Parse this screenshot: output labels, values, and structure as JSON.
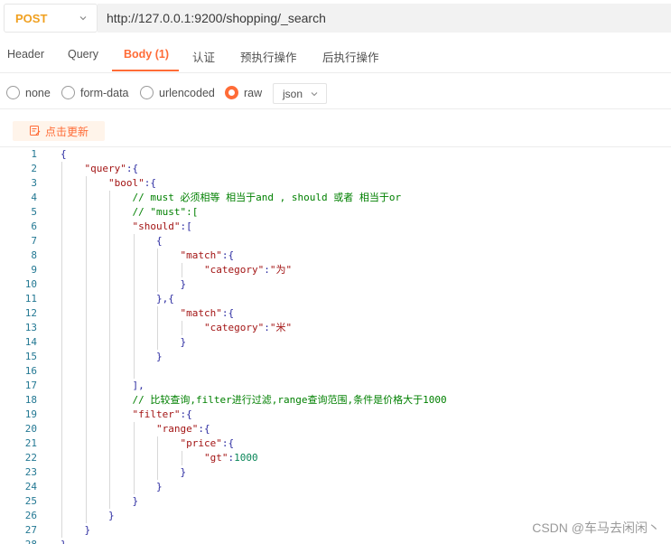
{
  "request": {
    "method": "POST",
    "url": "http://127.0.0.1:9200/shopping/_search"
  },
  "tabs": [
    {
      "label": "Header",
      "active": false
    },
    {
      "label": "Query",
      "active": false
    },
    {
      "label": "Body (1)",
      "active": true
    },
    {
      "label": "认证",
      "active": false
    },
    {
      "label": "预执行操作",
      "active": false
    },
    {
      "label": "后执行操作",
      "active": false
    }
  ],
  "body_type": {
    "options": [
      {
        "label": "none",
        "checked": false
      },
      {
        "label": "form-data",
        "checked": false
      },
      {
        "label": "urlencoded",
        "checked": false
      },
      {
        "label": "raw",
        "checked": true
      }
    ],
    "format": "json"
  },
  "toolbar": {
    "beautify_label": "点击更新",
    "beautify_icon": "beautify-icon"
  },
  "colors": {
    "accent": "#ff6c37",
    "method": "#f0a020",
    "line_number": "#237893",
    "punctuation": "#2a2aa0",
    "key": "#a31515",
    "number": "#098658",
    "comment": "#008000"
  },
  "editor": {
    "lines": [
      {
        "n": "1",
        "indent": 0,
        "tokens": [
          [
            "p",
            "{"
          ]
        ]
      },
      {
        "n": "2",
        "indent": 1,
        "tokens": [
          [
            "k",
            "\"query\""
          ],
          [
            "p",
            ":{"
          ]
        ]
      },
      {
        "n": "3",
        "indent": 2,
        "tokens": [
          [
            "k",
            "\"bool\""
          ],
          [
            "p",
            ":{"
          ]
        ]
      },
      {
        "n": "4",
        "indent": 3,
        "tokens": [
          [
            "c",
            "// must 必须相等 相当于and , should 或者 相当于or"
          ]
        ]
      },
      {
        "n": "5",
        "indent": 3,
        "tokens": [
          [
            "c",
            "// \"must\":["
          ]
        ]
      },
      {
        "n": "6",
        "indent": 3,
        "tokens": [
          [
            "k",
            "\"should\""
          ],
          [
            "p",
            ":["
          ]
        ]
      },
      {
        "n": "7",
        "indent": 4,
        "tokens": [
          [
            "p",
            "{"
          ]
        ]
      },
      {
        "n": "8",
        "indent": 5,
        "tokens": [
          [
            "k",
            "\"match\""
          ],
          [
            "p",
            ":{"
          ]
        ]
      },
      {
        "n": "9",
        "indent": 6,
        "tokens": [
          [
            "k",
            "\"category\""
          ],
          [
            "p",
            ":"
          ],
          [
            "k",
            "\"为\""
          ]
        ]
      },
      {
        "n": "10",
        "indent": 5,
        "tokens": [
          [
            "p",
            "}"
          ]
        ]
      },
      {
        "n": "11",
        "indent": 4,
        "tokens": [
          [
            "p",
            "},{"
          ]
        ]
      },
      {
        "n": "12",
        "indent": 5,
        "tokens": [
          [
            "k",
            "\"match\""
          ],
          [
            "p",
            ":{"
          ]
        ]
      },
      {
        "n": "13",
        "indent": 6,
        "tokens": [
          [
            "k",
            "\"category\""
          ],
          [
            "p",
            ":"
          ],
          [
            "k",
            "\"米\""
          ]
        ]
      },
      {
        "n": "14",
        "indent": 5,
        "tokens": [
          [
            "p",
            "}"
          ]
        ]
      },
      {
        "n": "15",
        "indent": 4,
        "tokens": [
          [
            "p",
            "}"
          ]
        ]
      },
      {
        "n": "16",
        "indent": 4,
        "tokens": []
      },
      {
        "n": "17",
        "indent": 3,
        "tokens": [
          [
            "p",
            "],"
          ]
        ]
      },
      {
        "n": "18",
        "indent": 3,
        "tokens": [
          [
            "c",
            "// 比较查询,filter进行过滤,range查询范围,条件是价格大于1000"
          ]
        ]
      },
      {
        "n": "19",
        "indent": 3,
        "tokens": [
          [
            "k",
            "\"filter\""
          ],
          [
            "p",
            ":{"
          ]
        ]
      },
      {
        "n": "20",
        "indent": 4,
        "tokens": [
          [
            "k",
            "\"range\""
          ],
          [
            "p",
            ":{"
          ]
        ]
      },
      {
        "n": "21",
        "indent": 5,
        "tokens": [
          [
            "k",
            "\"price\""
          ],
          [
            "p",
            ":{"
          ]
        ]
      },
      {
        "n": "22",
        "indent": 6,
        "tokens": [
          [
            "k",
            "\"gt\""
          ],
          [
            "p",
            ":"
          ],
          [
            "n",
            "1000"
          ]
        ]
      },
      {
        "n": "23",
        "indent": 5,
        "tokens": [
          [
            "p",
            "}"
          ]
        ]
      },
      {
        "n": "24",
        "indent": 4,
        "tokens": [
          [
            "p",
            "}"
          ]
        ]
      },
      {
        "n": "25",
        "indent": 3,
        "tokens": [
          [
            "p",
            "}"
          ]
        ]
      },
      {
        "n": "26",
        "indent": 2,
        "tokens": [
          [
            "p",
            "}"
          ]
        ]
      },
      {
        "n": "27",
        "indent": 1,
        "tokens": [
          [
            "p",
            "}"
          ]
        ]
      },
      {
        "n": "28",
        "indent": 0,
        "tokens": [
          [
            "p",
            "}"
          ]
        ]
      }
    ]
  },
  "watermark": "CSDN @车马去闲闲丶"
}
